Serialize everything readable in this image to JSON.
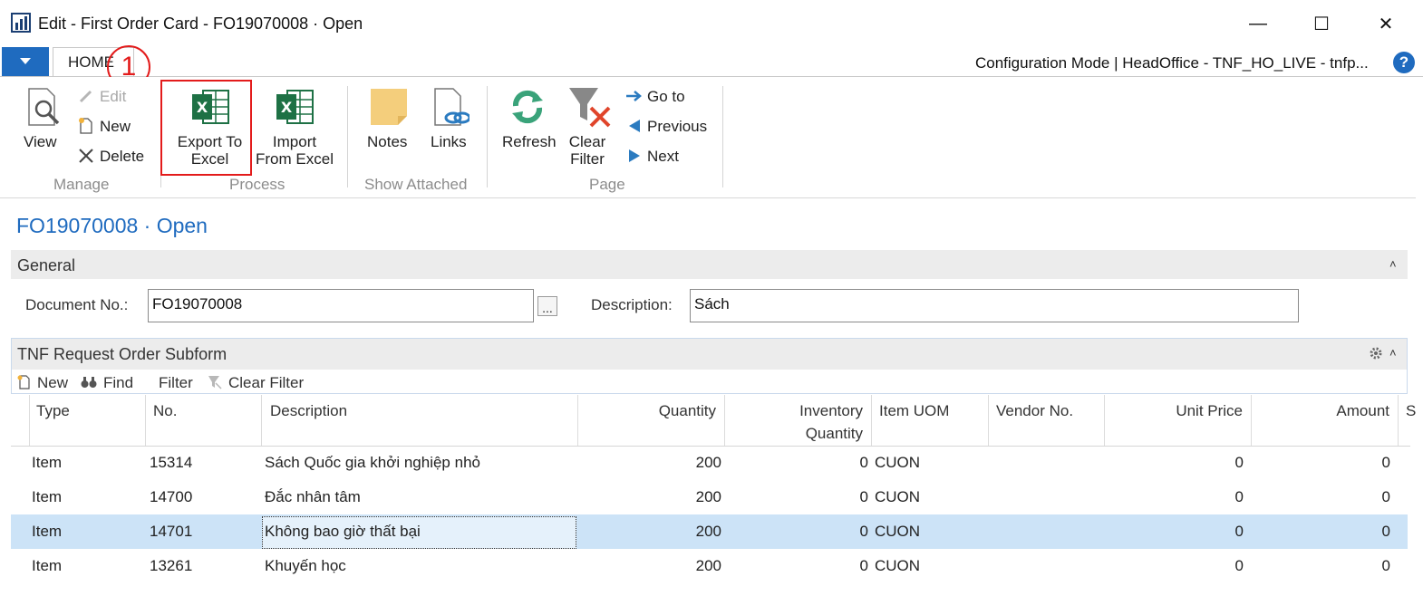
{
  "window": {
    "title": "Edit - First Order Card - FO19070008 · Open",
    "controls": {
      "minimize": "—",
      "maximize": "☐",
      "close": "✕"
    }
  },
  "ribbon": {
    "tab": "HOME",
    "callout_number": "1",
    "config_text": "Configuration Mode | HeadOffice - TNF_HO_LIVE - tnfp...",
    "help_label": "?",
    "manage": {
      "group_label": "Manage",
      "view": "View",
      "edit": "Edit",
      "new": "New",
      "delete": "Delete"
    },
    "process": {
      "group_label": "Process",
      "export_line1": "Export To",
      "export_line2": "Excel",
      "import_line1": "Import",
      "import_line2": "From Excel"
    },
    "show_attached": {
      "group_label": "Show Attached",
      "notes": "Notes",
      "links": "Links"
    },
    "page": {
      "group_label": "Page",
      "refresh": "Refresh",
      "clear_line1": "Clear",
      "clear_line2": "Filter",
      "go_to": "Go to",
      "previous": "Previous",
      "next": "Next"
    }
  },
  "page": {
    "title": "FO19070008 · Open",
    "general": {
      "label": "General",
      "document_no_label": "Document No.:",
      "document_no_value": "FO19070008",
      "lookup_label": "...",
      "description_label": "Description:",
      "description_value": "Sách"
    },
    "subform": {
      "title": "TNF Request Order Subform",
      "actions": {
        "new": "New",
        "find": "Find",
        "filter": "Filter",
        "clear_filter": "Clear Filter"
      },
      "columns": {
        "type": "Type",
        "no": "No.",
        "description": "Description",
        "quantity": "Quantity",
        "inventory_line1": "Inventory",
        "inventory_line2": "Quantity",
        "uom": "Item UOM",
        "vendor": "Vendor No.",
        "unit_price": "Unit Price",
        "amount": "Amount",
        "partial": "S"
      },
      "rows": [
        {
          "type": "Item",
          "no": "15314",
          "description": "Sách Quốc gia khởi nghiệp nhỏ",
          "quantity": "200",
          "inventory": "0",
          "uom": "CUON",
          "vendor": "",
          "unit_price": "0",
          "amount": "0"
        },
        {
          "type": "Item",
          "no": "14700",
          "description": "Đắc nhân tâm",
          "quantity": "200",
          "inventory": "0",
          "uom": "CUON",
          "vendor": "",
          "unit_price": "0",
          "amount": "0"
        },
        {
          "type": "Item",
          "no": "14701",
          "description": "Không bao giờ thất bại",
          "quantity": "200",
          "inventory": "0",
          "uom": "CUON",
          "vendor": "",
          "unit_price": "0",
          "amount": "0"
        },
        {
          "type": "Item",
          "no": "13261",
          "description": "Khuyến học",
          "quantity": "200",
          "inventory": "0",
          "uom": "CUON",
          "vendor": "",
          "unit_price": "0",
          "amount": "0"
        }
      ],
      "selected_row": 2
    }
  },
  "colors": {
    "accent": "#1f6bbf",
    "highlight_red": "#e31b1b",
    "selected_row": "#cce3f7",
    "excel_green": "#1e7145",
    "group_label": "#8c8c8c"
  },
  "icons": [
    "app-icon",
    "menu-dropdown-icon",
    "help-icon",
    "view-icon",
    "edit-icon",
    "new-icon",
    "delete-icon",
    "excel-export-icon",
    "excel-import-icon",
    "notes-icon",
    "links-icon",
    "refresh-icon",
    "clear-filter-icon",
    "go-to-icon",
    "previous-icon",
    "next-icon",
    "collapse-chevron-icon",
    "settings-icon",
    "find-icon",
    "filter-icon"
  ]
}
